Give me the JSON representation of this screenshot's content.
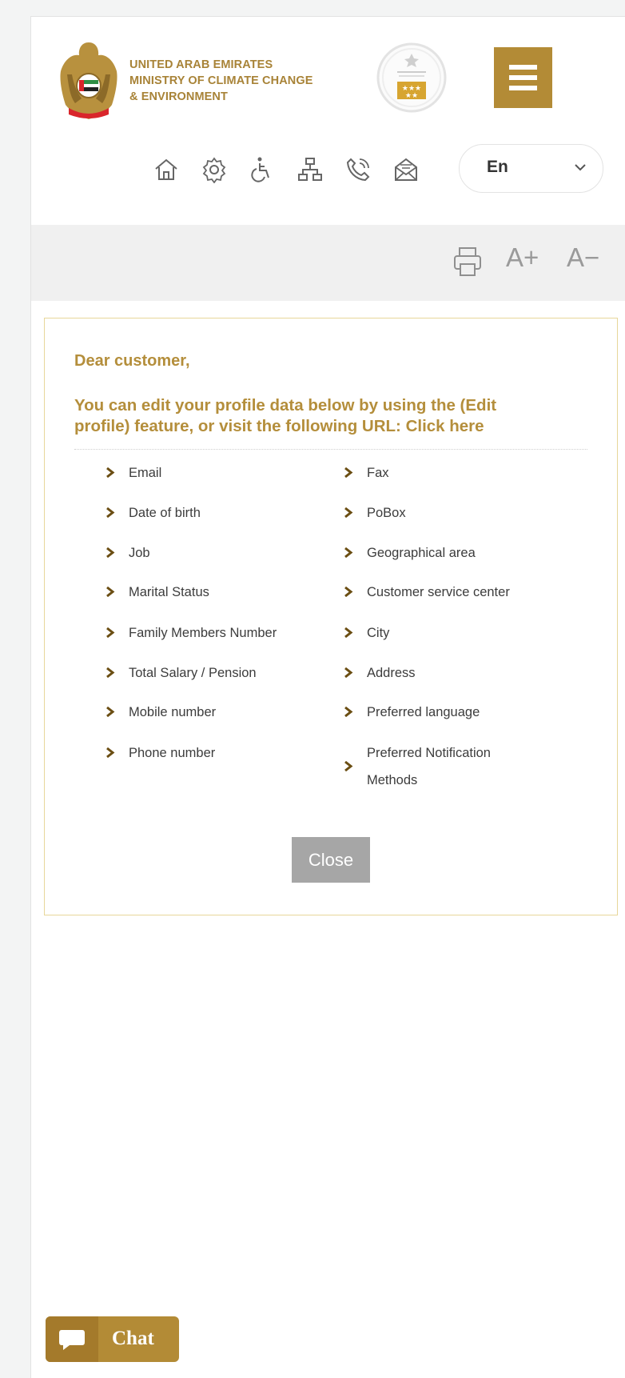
{
  "header": {
    "ministry_lines": [
      "UNITED ARAB EMIRATES",
      "MINISTRY OF CLIMATE CHANGE",
      "& ENVIRONMENT"
    ],
    "menu_button": "hamburger-menu-icon",
    "icons": [
      "home-icon",
      "settings-icon",
      "accessibility-icon",
      "sitemap-icon",
      "phone-icon",
      "mail-icon"
    ],
    "language": "En",
    "brand_color": "#b38b36"
  },
  "toolbar": {
    "print_icon": "print-icon",
    "increase_font": "A+",
    "decrease_font": "A−"
  },
  "notice": {
    "greeting": "Dear customer,",
    "intro": "You can edit your profile data below by using the (Edit profile) feature, or visit the following URL: Click here",
    "left_items": [
      "Email",
      "Date of birth",
      "Job",
      "Marital Status",
      "Family Members Number",
      "Total Salary / Pension",
      "Mobile number",
      "Phone number"
    ],
    "right_items": [
      "Fax",
      "PoBox",
      "Geographical area",
      "Customer service center",
      "City",
      "Address",
      "Preferred language",
      "Preferred Notification Methods"
    ],
    "close_label": "Close"
  },
  "chat": {
    "label": "Chat"
  }
}
